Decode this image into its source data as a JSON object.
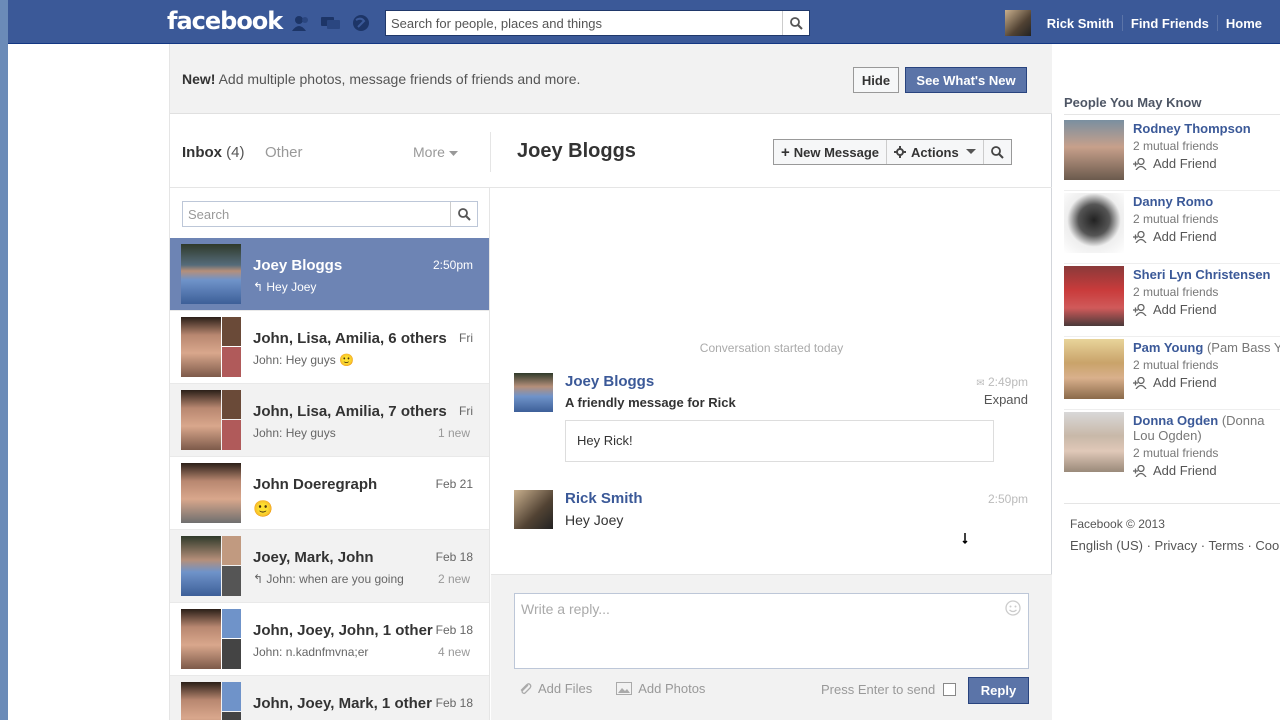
{
  "topbar": {
    "logo": "facebook",
    "search_placeholder": "Search for people, places and things",
    "user_name": "Rick Smith",
    "find_friends": "Find Friends",
    "home": "Home"
  },
  "notice": {
    "bold": "New!",
    "text": " Add multiple photos, message friends of friends and more.",
    "hide_label": "Hide",
    "see_label": "See What's New"
  },
  "inbox": {
    "tab_inbox": "Inbox",
    "count": "(4)",
    "tab_other": "Other",
    "more": "More",
    "search_placeholder": "Search"
  },
  "threads": [
    {
      "name": "Joey Bloggs",
      "time": "2:50pm",
      "snippet": "Hey Joey",
      "new": ""
    },
    {
      "name": "John, Lisa, Amilia, 6 others",
      "time": "Fri",
      "snippet": "John: Hey guys",
      "new": ""
    },
    {
      "name": "John, Lisa, Amilia, 7 others",
      "time": "Fri",
      "snippet": "John: Hey guys",
      "new": "1 new"
    },
    {
      "name": "John Doeregraph",
      "time": "Feb 21",
      "snippet": "",
      "new": ""
    },
    {
      "name": "Joey, Mark, John",
      "time": "Feb 18",
      "snippet": "John: when are you going",
      "new": "2 new"
    },
    {
      "name": "John, Joey, John, 1 other",
      "time": "Feb 18",
      "snippet": "John: n.kadnfmvna;er",
      "new": "4 new"
    },
    {
      "name": "John, Joey, Mark, 1 other",
      "time": "Feb 18",
      "snippet": "",
      "new": ""
    }
  ],
  "conversation": {
    "title": "Joey Bloggs",
    "new_message": "New Message",
    "actions": "Actions",
    "started": "Conversation started today",
    "messages": [
      {
        "name": "Joey Bloggs",
        "time": "2:49pm",
        "expand": "Expand",
        "subject": "A friendly message for Rick",
        "body": "Hey Rick!"
      },
      {
        "name": "Rick Smith",
        "time": "2:50pm",
        "body": "Hey Joey"
      }
    ]
  },
  "reply": {
    "placeholder": "Write a reply...",
    "add_files": "Add Files",
    "add_photos": "Add Photos",
    "press_enter": "Press Enter to send",
    "reply_label": "Reply"
  },
  "people_you_may_know": {
    "title": "People You May Know",
    "add_label": "Add Friend",
    "people": [
      {
        "name": "Rodney Thompson",
        "alt": "",
        "mutual": "2 mutual friends"
      },
      {
        "name": "Danny Romo",
        "alt": "",
        "mutual": "2 mutual friends"
      },
      {
        "name": "Sheri Lyn Christensen",
        "alt": "",
        "mutual": "2 mutual friends"
      },
      {
        "name": "Pam Young",
        "alt": "(Pam Bass Young)",
        "mutual": "2 mutual friends"
      },
      {
        "name": "Donna Ogden",
        "alt": "(Donna Lou Ogden)",
        "mutual": "2 mutual friends"
      }
    ]
  },
  "footer": {
    "copyright": "Facebook © 2013",
    "links": "English (US) · Privacy · Terms · Cookies"
  },
  "colors": {
    "brand_blue": "#3b5998",
    "selected_row": "#6d84b4",
    "button_blue": "#5b74a8"
  }
}
